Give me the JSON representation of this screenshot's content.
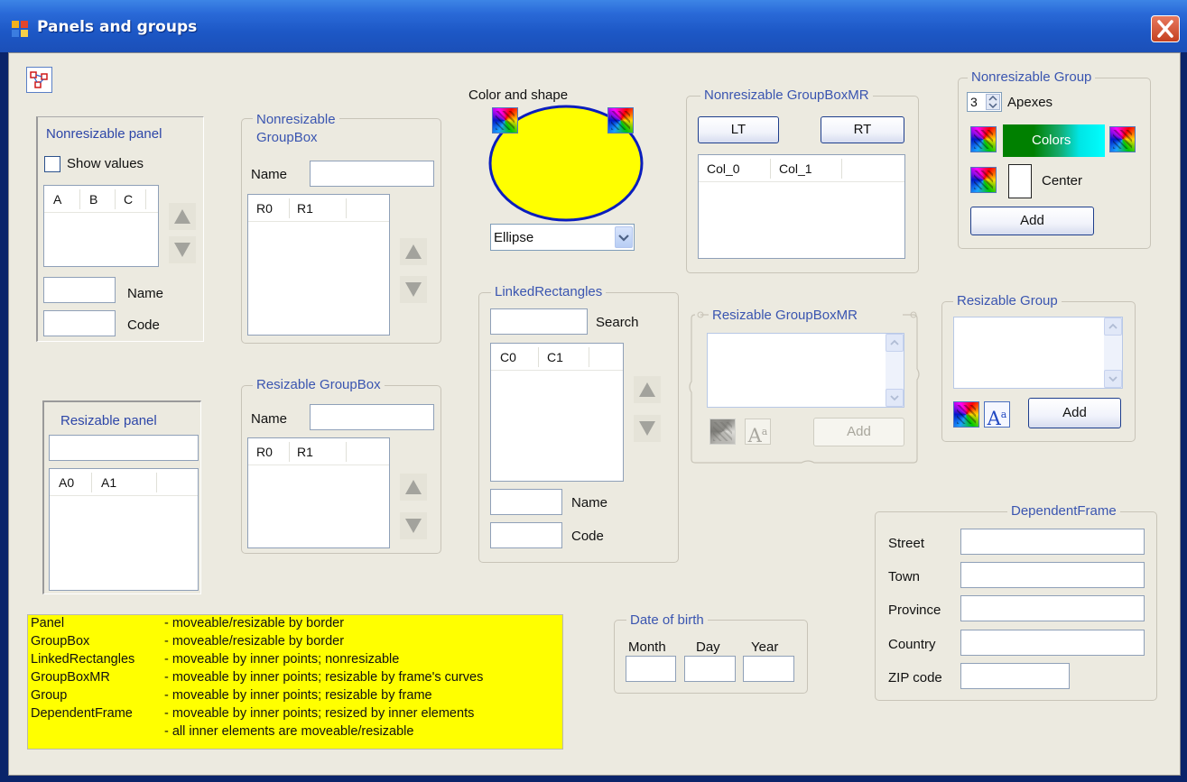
{
  "window": {
    "title": "Panels and groups"
  },
  "panels": {
    "nonresizable_panel": {
      "title": "Nonresizable panel",
      "checkbox_label": "Show values",
      "columns": [
        "A",
        "B",
        "C"
      ],
      "name_label": "Name",
      "code_label": "Code"
    },
    "resizable_panel": {
      "title": "Resizable panel",
      "columns": [
        "A0",
        "A1"
      ]
    }
  },
  "groupboxes": {
    "nonresizable_groupbox": {
      "title_line1": "Nonresizable",
      "title_line2": "GroupBox",
      "name_label": "Name",
      "columns": [
        "R0",
        "R1"
      ]
    },
    "resizable_groupbox": {
      "title": "Resizable GroupBox",
      "name_label": "Name",
      "columns": [
        "R0",
        "R1"
      ]
    }
  },
  "color_shape": {
    "label": "Color and shape",
    "fill_color": "#ffff00",
    "outline_color": "#0a1dbd",
    "shape_selected": "Ellipse"
  },
  "linked_rectangles": {
    "title": "LinkedRectangles",
    "search_label": "Search",
    "columns": [
      "C0",
      "C1"
    ],
    "name_label": "Name",
    "code_label": "Code"
  },
  "nonresizable_groupboxmr": {
    "title": "Nonresizable GroupBoxMR",
    "buttons": [
      "LT",
      "RT"
    ],
    "columns": [
      "Col_0",
      "Col_1"
    ]
  },
  "resizable_groupboxmr": {
    "title": "Resizable GroupBoxMR",
    "add_label": "Add"
  },
  "nonresizable_group": {
    "title": "Nonresizable Group",
    "apexes_value": "3",
    "apexes_label": "Apexes",
    "colors_label": "Colors",
    "center_label": "Center",
    "add_label": "Add"
  },
  "resizable_group": {
    "title": "Resizable Group",
    "add_label": "Add"
  },
  "dependent_frame": {
    "title": "DependentFrame",
    "fields": [
      "Street",
      "Town",
      "Province",
      "Country",
      "ZIP code"
    ]
  },
  "date_of_birth": {
    "title": "Date of birth",
    "labels": [
      "Month",
      "Day",
      "Year"
    ]
  },
  "legend": {
    "background": "#ffff00",
    "rows": [
      {
        "key": "Panel",
        "desc": "- moveable/resizable by border"
      },
      {
        "key": "GroupBox",
        "desc": "- moveable/resizable by border"
      },
      {
        "key": "LinkedRectangles",
        "desc": "- moveable by inner points; nonresizable"
      },
      {
        "key": "GroupBoxMR",
        "desc": "- moveable by inner points; resizable by frame's curves"
      },
      {
        "key": "Group",
        "desc": "- moveable by inner points; resizable by frame"
      },
      {
        "key": "DependentFrame",
        "desc": "- moveable by inner points; resized by inner elements"
      },
      {
        "key": "",
        "desc": "- all inner elements are moveable/resizable"
      }
    ]
  }
}
